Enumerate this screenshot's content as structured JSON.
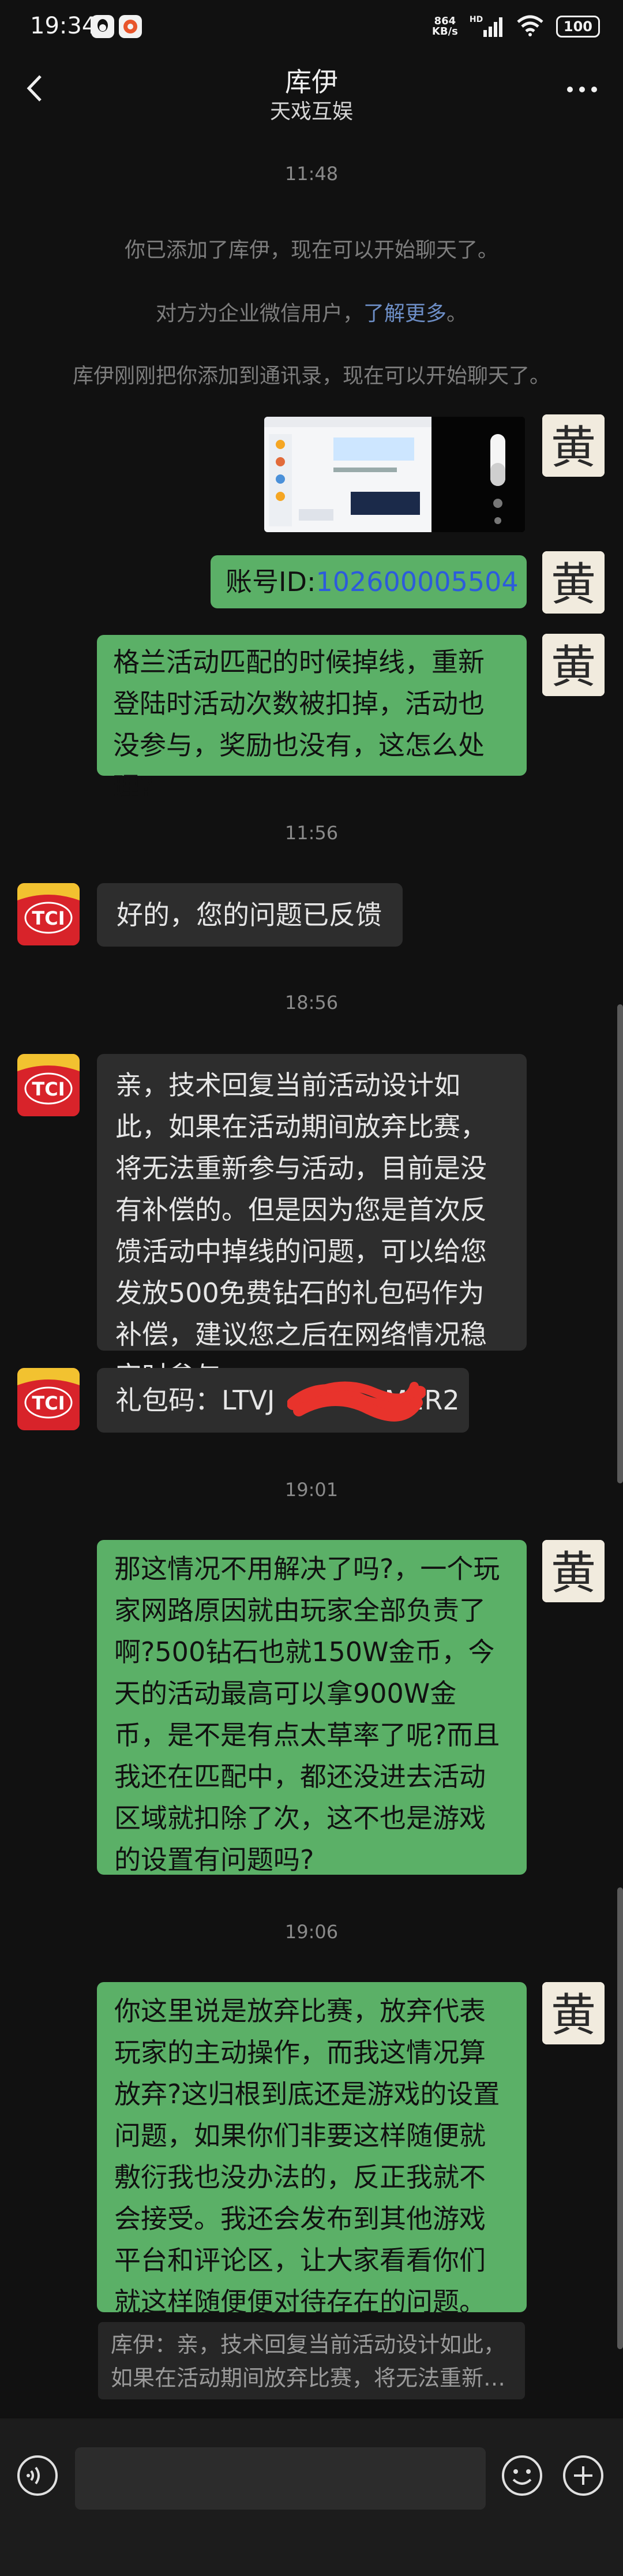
{
  "status_bar": {
    "time": "19:34",
    "net_speed_value": "864",
    "net_speed_unit": "KB/s",
    "network_type": "HD",
    "battery": "100"
  },
  "nav": {
    "title": "库伊",
    "subtitle": "天戏互娱"
  },
  "timestamps": [
    "11:48",
    "11:56",
    "18:56",
    "19:01",
    "19:06"
  ],
  "system_messages": {
    "added": "你已添加了库伊，现在可以开始聊天了。",
    "wecom_prefix": "对方为企业微信用户，",
    "wecom_link": "了解更多",
    "wecom_suffix": "。",
    "contact_added": "库伊刚刚把你添加到通讯录，现在可以开始聊天了。"
  },
  "messages": {
    "account_prefix": "账号ID:",
    "account_id": "102600005504",
    "complaint": "格兰活动匹配的时候掉线，重新登陆时活动次数被扣掉，活动也没参与，奖励也没有，这怎么处理?",
    "reply_received": "好的，您的问题已反馈",
    "reply_tech": "亲，技术回复当前活动设计如此，如果在活动期间放弃比赛，将无法重新参与活动，目前是没有补偿的。但是因为您是首次反馈活动中掉线的问题，可以给您发放500免费钻石的礼包码作为补偿，建议您之后在网络情况稳定时参与",
    "gift_prefix": "礼包码：LTVJ",
    "gift_suffix": "M1R2",
    "followup": "那这情况不用解决了吗?，一个玩家网路原因就由玩家全部负责了啊?500钻石也就150W金币，今天的活动最高可以拿900W金币，是不是有点太草率了呢?而且我还在匹配中，都还没进去活动区域就扣除了次，这不也是游戏的设置有问题吗?",
    "final": "你这里说是放弃比赛，放弃代表玩家的主动操作，而我这情况算放弃?这归根到底还是游戏的设置问题，如果你们非要这样随便就敷衍我也没办法的，反正我就不会接受。我还会发布到其他游戏平台和评论区，让大家看看你们就这样随便便对待存在的问题。",
    "quote": "库伊：亲，技术回复当前活动设计如此，如果在活动期间放弃比赛，将无法重新…"
  },
  "avatars": {
    "me_char": "黄",
    "service_logo": "TCI"
  },
  "colors": {
    "background": "#111111",
    "my_bubble": "#5bb067",
    "their_bubble": "#2d2d2d",
    "link": "#2c5bdc",
    "logo_red": "#d8232a",
    "logo_yellow": "#f2c230"
  },
  "icons": {
    "back": "chevron-left-icon",
    "more": "more-dots-icon",
    "voice": "voice-input-icon",
    "emoji": "emoji-icon",
    "plus": "plus-icon"
  }
}
